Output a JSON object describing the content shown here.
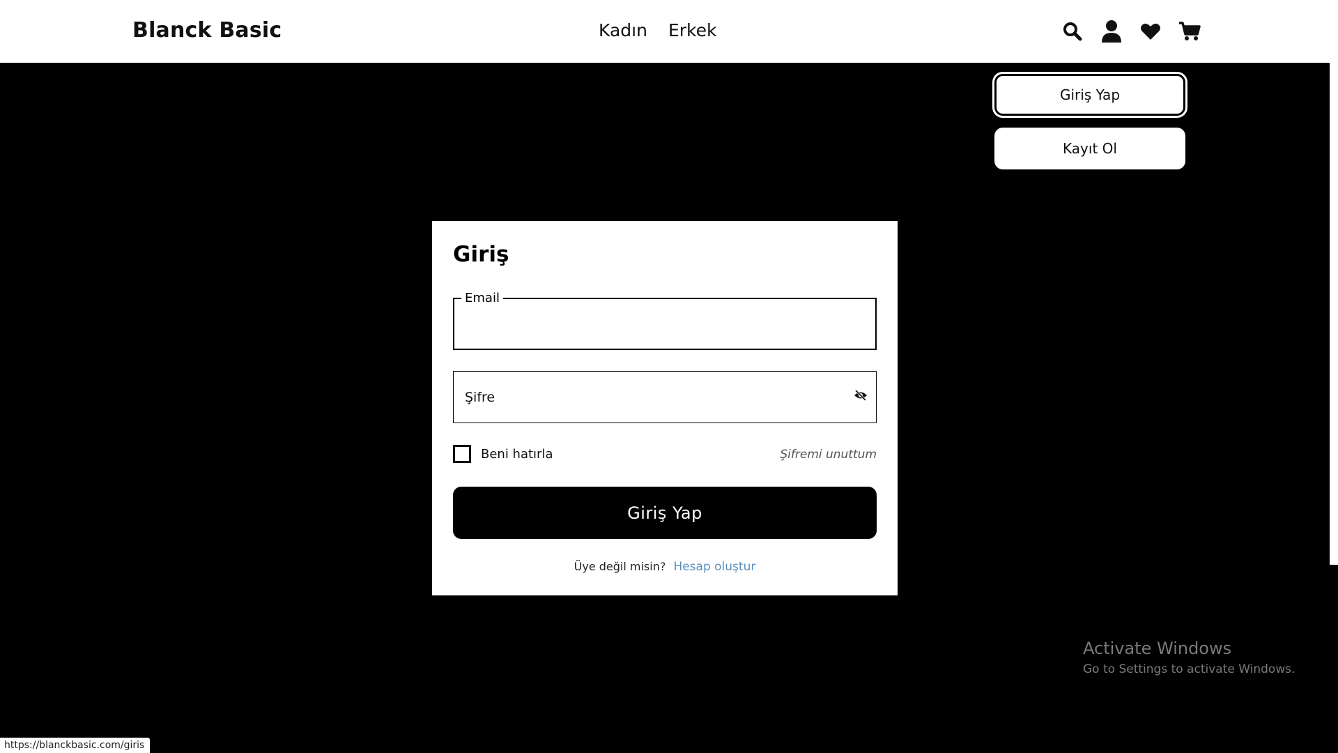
{
  "header": {
    "brand": "Blanck Basic",
    "nav": [
      "Kadın",
      "Erkek"
    ],
    "icons": [
      "search-icon",
      "user-icon",
      "heart-icon",
      "cart-icon"
    ]
  },
  "account_menu": {
    "login_label": "Giriş Yap",
    "register_label": "Kayıt Ol"
  },
  "login": {
    "title": "Giriş",
    "email_label": "Email",
    "email_value": "",
    "password_placeholder": "Şifre",
    "remember_label": "Beni hatırla",
    "remember_checked": false,
    "forgot_label": "Şifremi unuttum",
    "submit_label": "Giriş Yap",
    "signup_prompt": "Üye değil misin?",
    "signup_link": "Hesap oluştur"
  },
  "watermark": {
    "title": "Activate Windows",
    "subtitle": "Go to Settings to activate Windows."
  },
  "status_bar": {
    "url": "https://blanckbasic.com/giris"
  },
  "colors": {
    "background": "#000000",
    "surface": "#ffffff",
    "link": "#5a8fbf",
    "watermark": "#7a7a7a"
  }
}
